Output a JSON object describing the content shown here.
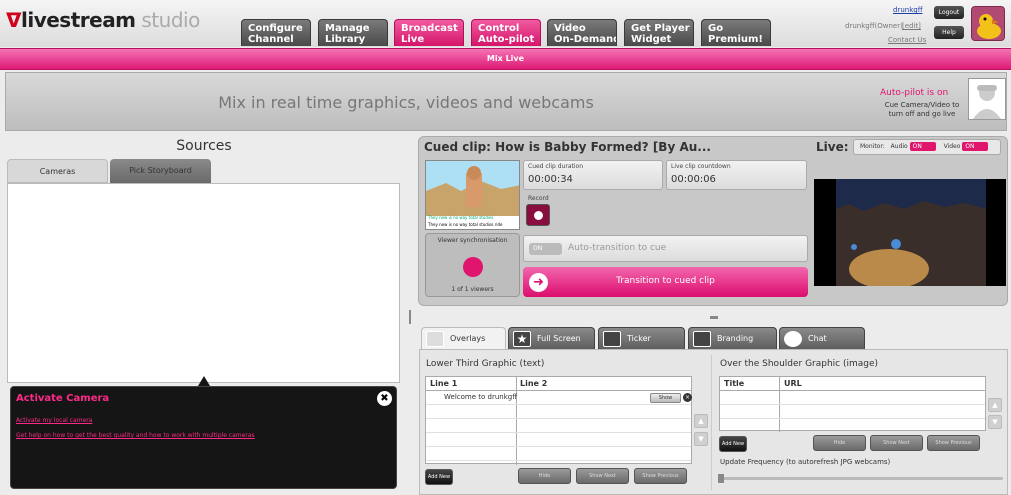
{
  "app": {
    "logo_main": "livestream",
    "logo_sub": "studio"
  },
  "nav": {
    "tabs": [
      {
        "label_1": "Configure",
        "label_2": "Channel",
        "active": false
      },
      {
        "label_1": "Manage",
        "label_2": "Library",
        "active": false
      },
      {
        "label_1": "Broadcast",
        "label_2": "Live",
        "active": true
      },
      {
        "label_1": "Control",
        "label_2": "Auto-pilot",
        "active": true
      },
      {
        "label_1": "Video",
        "label_2": "On-Demand",
        "active": false
      },
      {
        "label_1": "Get Player",
        "label_2": "Widget",
        "active": false
      },
      {
        "label_1": "Go",
        "label_2": "Premium!",
        "active": false
      }
    ]
  },
  "user": {
    "username": "drunkgff",
    "role": "drunkgff(Owner)",
    "edit": "[edit]",
    "contact": "Contact Us",
    "logout": "Logout",
    "help": "Help"
  },
  "subnav": {
    "label": "Mix Live"
  },
  "banner": {
    "text": "Mix in real time graphics, videos and webcams",
    "autopilot_status": "Auto-pilot is on",
    "autopilot_desc": "Cue Camera/Video to turn off and go live"
  },
  "sources": {
    "title": "Sources",
    "tabs": [
      "Cameras",
      "Pick Storyboard"
    ],
    "activate": {
      "title": "Activate Camera",
      "link1": "Activate my local camera",
      "link2": "Get help on how to get the best quality and how to work with multiple cameras",
      "close": "✖"
    }
  },
  "cue": {
    "title": "Cued clip: How is Babby Formed? [By Au...",
    "duration_label": "Cued clip  duration",
    "duration_value": "00:00:34",
    "countdown_label": "Live clip countdown",
    "countdown_value": "00:00:06",
    "record_label": "Record",
    "sync_label": "Viewer synchronisation",
    "viewers": "1 of 1 viewers",
    "auto_toggle": "ON",
    "auto_label": "Auto-transition to cue",
    "transition": "Transition to cued clip",
    "caption_top": "They now is no way total studies",
    "caption_sub": "They new is no way total studios ride"
  },
  "live": {
    "label": "Live:",
    "monitor_label": "Monitor:",
    "audio_label": "Audio",
    "audio_state": "ON",
    "video_label": "Video",
    "video_state": "ON"
  },
  "bottom": {
    "tabs": [
      "Overlays",
      "Full Screen",
      "Ticker",
      "Branding",
      "Chat"
    ],
    "lower_third": {
      "title": "Lower Third Graphic (text)",
      "col1": "Line 1",
      "col2": "Line 2",
      "row1_line1": "Welcome to drunkgff",
      "show": "Show",
      "add": "Add New",
      "hide": "Hide",
      "show_next": "Show Next",
      "show_prev": "Show Previous"
    },
    "shoulder": {
      "title": "Over the Shoulder Graphic (image)",
      "col1": "Title",
      "col2": "URL",
      "add": "Add New",
      "hide": "Hide",
      "show_next": "Show Next",
      "show_prev": "Show Previous",
      "update_label": "Update Frequency (to autorefresh JPG webcams)"
    }
  },
  "colors": {
    "accent": "#e0156e",
    "nav_dark": "#5a5a5a",
    "panel_bg": "#c8c8c8"
  }
}
